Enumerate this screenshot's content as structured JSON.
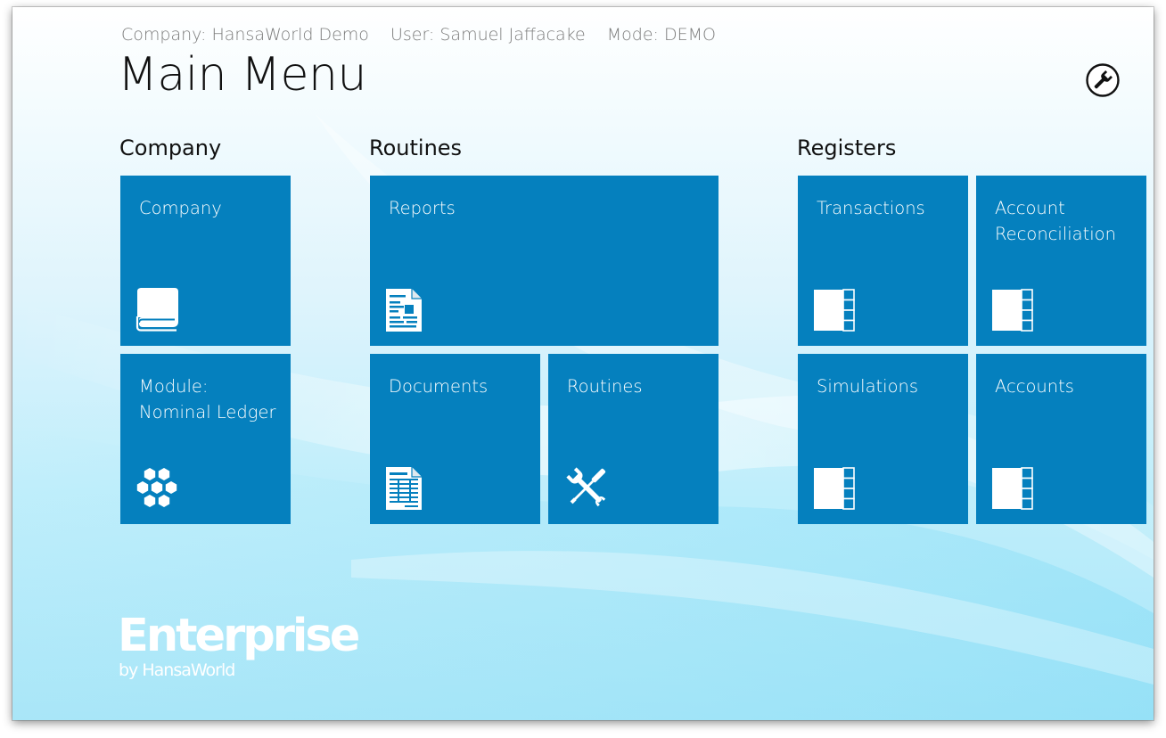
{
  "header": {
    "company": "Company: HansaWorld Demo",
    "user": "User: Samuel Jaffacake",
    "mode": "Mode: DEMO"
  },
  "page_title": "Main Menu",
  "groups": {
    "company": "Company",
    "routines": "Routines",
    "registers": "Registers"
  },
  "tiles": {
    "company": "Company",
    "module": "Module:\nNominal Ledger",
    "reports": "Reports",
    "documents": "Documents",
    "routines": "Routines",
    "transactions": "Transactions",
    "account_reconciliation": "Account\nReconciliation",
    "simulations": "Simulations",
    "accounts": "Accounts"
  },
  "icons": {
    "settings": "wrench-icon",
    "company": "book-icon",
    "module": "hexagon-cluster-icon",
    "reports": "report-document-icon",
    "documents": "form-document-icon",
    "routines": "tools-icon",
    "registers": "ledger-tabs-icon"
  },
  "logo": {
    "main": "Enterprise",
    "sub": "by HansaWorld"
  },
  "colors": {
    "tile": "#0580be",
    "title": "#111111",
    "header": "#7b7b7b"
  }
}
